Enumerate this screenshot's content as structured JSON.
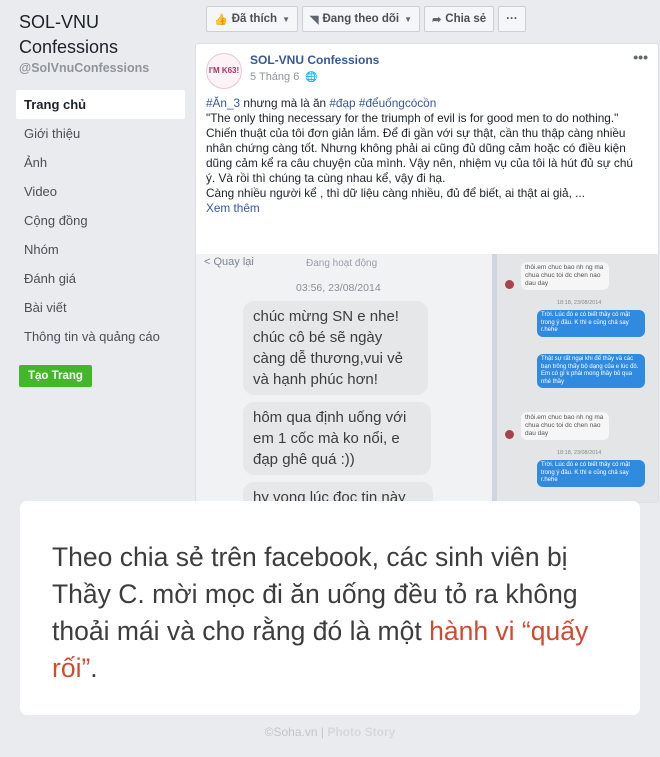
{
  "page": {
    "name": "SOL-VNU Confessions",
    "handle": "@SolVnuConfessions",
    "nav": [
      "Trang chủ",
      "Giới thiệu",
      "Ảnh",
      "Video",
      "Cộng đồng",
      "Nhóm",
      "Đánh giá",
      "Bài viết",
      "Thông tin và quảng cáo"
    ],
    "active_nav": "Trang chủ",
    "create_page_label": "Tạo Trang"
  },
  "actions": {
    "like_label": "Đã thích",
    "follow_label": "Đang theo dõi",
    "share_label": "Chia sẻ",
    "more_label": "···"
  },
  "post": {
    "author": "SOL-VNU Confessions",
    "avatar_text": "I'M K63!",
    "date": "5 Tháng 6",
    "more": "•••",
    "hashtag_intro": "#Ăn_3",
    "intro_text": " nhưng mà là ăn ",
    "hashtag_2": "#đạp",
    "hashtag_3": "#đểuốngcócồn",
    "quote": "\"The only thing necessary for the triumph of evil is for good men to do nothing.\"",
    "paragraph_1": "Chiến thuật của tôi đơn giản lắm. Để đi gần với sự thật, cần thu thập càng nhiều nhân chứng càng tốt. Nhưng không phải ai cũng đủ dũng cảm hoặc có điều kiện dũng cảm kể ra câu chuyện của mình. Vậy nên, nhiệm vụ của tôi là hút đủ sự chú ý. Và rồi thì chúng ta cùng nhau kể, vậy đi hạ.",
    "paragraph_2": "Càng nhiều người kể , thì dữ liệu càng nhiều, đủ để biết, ai thật ai giả, ...",
    "see_more": "Xem thêm"
  },
  "chat": {
    "back_label": "< Quay lại",
    "status": "Đang hoạt động",
    "timestamp": "03:56, 23/08/2014",
    "messages": [
      "chúc mừng SN e nhe! chúc cô bé sẽ ngày càng dễ thương,vui vẻ và hạnh phúc hơn!",
      "hôm qua định uống với em 1 cốc mà ko nổi, e đạp ghê quá :))",
      "hy vọng lúc đọc tin này"
    ],
    "right_incoming": "thôi.em chuc bao nh ng ma chua chuc toi dc chen nao dau day",
    "right_outgoing_1": "Trời. Lúc đó e có biết thầy có mặt trong ý đâu. K thì e cũng chả say r.hehe",
    "right_outgoing_2": "Thật sự rất ngại khi để thầy và các bạn trông thấy bộ dạng của e lúc đó. Em có gì k phải mong thầy bỏ qua nhé thầy",
    "right_stamp": "18:18, 23/08/2014"
  },
  "caption": {
    "text_before": "Theo chia sẻ trên facebook, các sinh viên bị Thầy C. mời mọc đi ăn uống đều tỏ ra không thoải mái và cho rằng đó là một ",
    "highlight": "hành vi “quấy rối”",
    "text_after": "."
  },
  "credit": {
    "source": "©Soha.vn",
    "separator": " | ",
    "series": "Photo Story"
  },
  "colors": {
    "facebook_link": "#365899",
    "highlight": "#d34a30",
    "create_button": "#42b72a",
    "messenger_blue": "#2f8ae0"
  }
}
